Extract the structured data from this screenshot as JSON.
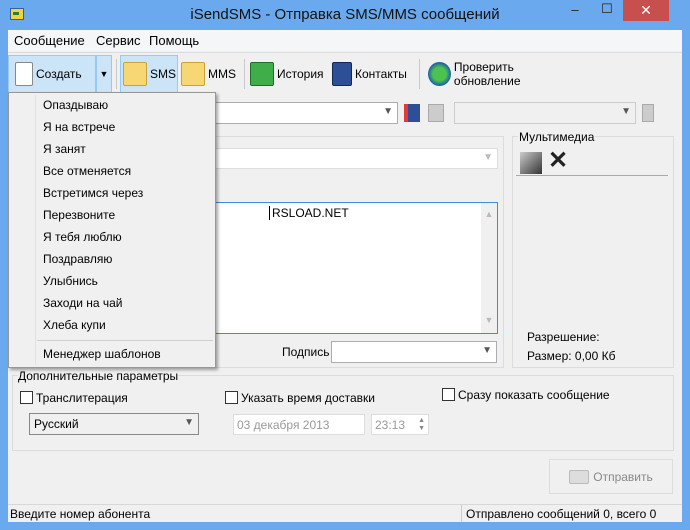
{
  "window": {
    "title": "iSendSMS - Отправка SMS/MMS сообщений",
    "minimize": "‒",
    "maximize": "☐",
    "close": "✕"
  },
  "menubar": [
    "Сообщение",
    "Сервис",
    "Помощь"
  ],
  "toolbar": {
    "create": "Создать",
    "sms": "SMS",
    "mms": "MMS",
    "history": "История",
    "contacts": "Контакты",
    "update": "Проверить обновление"
  },
  "dropdown": {
    "items": [
      "Опаздываю",
      "Я на встрече",
      "Я занят",
      "Все отменяется",
      "Встретимся через",
      "Перезвоните",
      "Я тебя люблю",
      "Поздравляю",
      "Улыбнись",
      "Заходи на чай",
      "Хлеба купи"
    ],
    "manager": "Менеджер шаблонов"
  },
  "message": {
    "text": "RSLOAD.NET",
    "signature_label": "Подпись",
    "signature_value": ""
  },
  "multimedia": {
    "title": "Мультимедиа",
    "resolution": "Разрешение:",
    "size": "Размер: 0,00 Кб"
  },
  "options": {
    "title": "Дополнительные параметры",
    "translit": "Транслитерация",
    "language": "Русский",
    "delivery_time": "Указать время доставки",
    "date": "03 декабря  2013",
    "time": "23:13",
    "flash": "Сразу показать сообщение"
  },
  "send": "Отправить",
  "status": {
    "left": "Введите номер абонента",
    "right": "Отправлено сообщений 0, всего 0"
  }
}
